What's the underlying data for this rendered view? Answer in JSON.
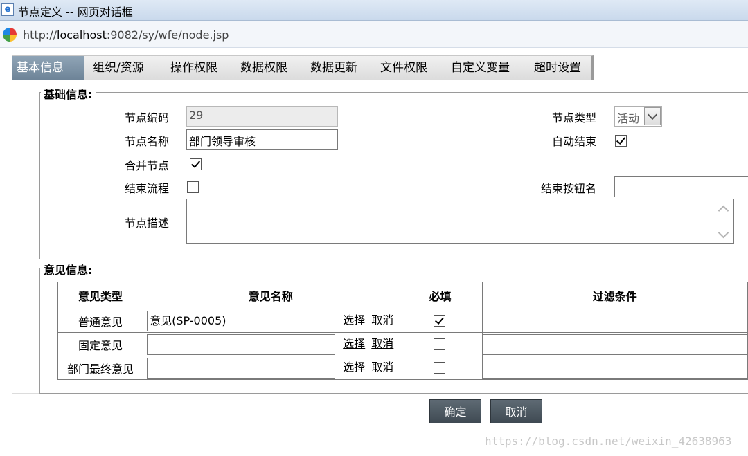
{
  "window": {
    "title": "节点定义 -- 网页对话框",
    "url_prefix": "http://",
    "url_host": "localhost",
    "url_rest": ":9082/sy/wfe/node.jsp"
  },
  "tabs": [
    {
      "label": "基本信息",
      "active": true
    },
    {
      "label": "组织/资源"
    },
    {
      "label": "操作权限"
    },
    {
      "label": "数据权限"
    },
    {
      "label": "数据更新"
    },
    {
      "label": "文件权限"
    },
    {
      "label": "自定义变量"
    },
    {
      "label": "超时设置"
    }
  ],
  "basic_info": {
    "legend": "基础信息:",
    "node_code_label": "节点编码",
    "node_code_value": "29",
    "node_name_label": "节点名称",
    "node_name_value": "部门领导审核",
    "merge_node_label": "合并节点",
    "merge_node_checked": true,
    "end_flow_label": "结束流程",
    "end_flow_checked": false,
    "node_desc_label": "节点描述",
    "node_desc_value": "",
    "node_type_label": "节点类型",
    "node_type_value": "活动",
    "auto_end_label": "自动结束",
    "auto_end_checked": true,
    "end_button_label": "结束按钮名",
    "end_button_value": ""
  },
  "opinion_info": {
    "legend": "意见信息:",
    "headers": [
      "意见类型",
      "意见名称",
      "必填",
      "过滤条件"
    ],
    "select_label": "选择",
    "cancel_label": "取消",
    "rows": [
      {
        "type": "普通意见",
        "name": "意见(SP-0005)",
        "required": true,
        "filter": ""
      },
      {
        "type": "固定意见",
        "name": "",
        "required": false,
        "filter": ""
      },
      {
        "type": "部门最终意见",
        "name": "",
        "required": false,
        "filter": ""
      }
    ]
  },
  "buttons": {
    "ok": "确定",
    "cancel": "取消"
  },
  "watermark": "https://blog.csdn.net/weixin_42638963"
}
